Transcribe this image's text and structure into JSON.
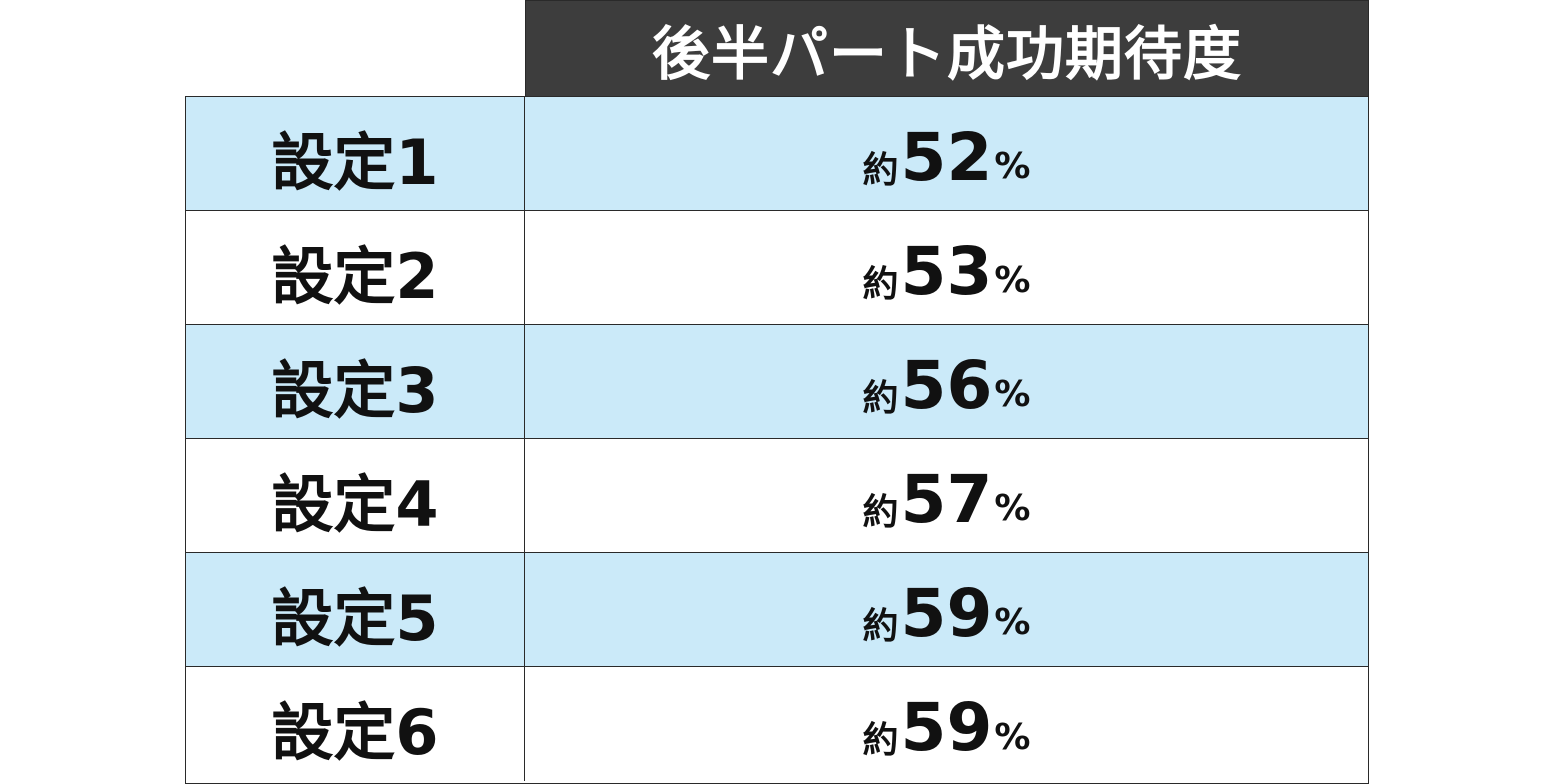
{
  "header": {
    "title": "後半パート成功期待度"
  },
  "rows": [
    {
      "label": "設定1",
      "prefix": "約",
      "value": "52",
      "unit": "%"
    },
    {
      "label": "設定2",
      "prefix": "約",
      "value": "53",
      "unit": "%"
    },
    {
      "label": "設定3",
      "prefix": "約",
      "value": "56",
      "unit": "%"
    },
    {
      "label": "設定4",
      "prefix": "約",
      "value": "57",
      "unit": "%"
    },
    {
      "label": "設定5",
      "prefix": "約",
      "value": "59",
      "unit": "%"
    },
    {
      "label": "設定6",
      "prefix": "約",
      "value": "59",
      "unit": "%"
    }
  ],
  "colors": {
    "header_bg": "#3d3d3d",
    "header_text": "#ffffff",
    "alt_row": "#cbeaf9",
    "plain_row": "#ffffff",
    "border": "#2a2a2a"
  }
}
